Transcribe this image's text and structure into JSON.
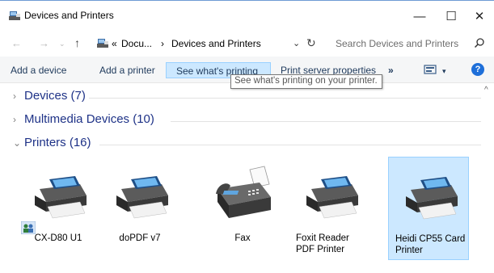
{
  "window": {
    "title": "Devices and Printers",
    "minimize_glyph": "—",
    "maximize_glyph": "☐",
    "close_glyph": "✕"
  },
  "address_bar": {
    "back_glyph": "←",
    "forward_glyph": "→",
    "recent_glyph": "⌄",
    "up_glyph": "↑",
    "overflow_chevron": "«",
    "crumbs": [
      "Docu...",
      "Devices and Printers"
    ],
    "crumb_separator": "›",
    "dropdown_glyph": "⌄",
    "refresh_glyph": "↻"
  },
  "search": {
    "placeholder": "Search Devices and Printers"
  },
  "toolbar": {
    "add_device": "Add a device",
    "add_printer": "Add a printer",
    "see_printing": "See what's printing",
    "print_server": "Print server properties",
    "more": "»",
    "view_dropdown": "▾",
    "help": "?"
  },
  "tooltip": {
    "text": "See what's printing on your printer."
  },
  "groups": [
    {
      "label": "Devices (7)",
      "chevron": "›"
    },
    {
      "label": "Multimedia Devices (10)",
      "chevron": "›"
    },
    {
      "label": "Printers (16)",
      "chevron": "⌄"
    }
  ],
  "devices": [
    {
      "label": "CX-D80 U1",
      "icon": "printer-icon"
    },
    {
      "label": "doPDF v7",
      "icon": "printer-icon"
    },
    {
      "label": "Fax",
      "icon": "fax-icon"
    },
    {
      "label": "Foxit Reader PDF Printer",
      "icon": "printer-icon"
    },
    {
      "label": "Heidi CP55 Card Printer",
      "icon": "printer-icon",
      "selected": true
    }
  ],
  "colors": {
    "accent": "#cce8ff",
    "accent_border": "#99d1ff",
    "group_text": "#1e3287",
    "help_blue": "#1e6fd9"
  },
  "scrollbar": {
    "up_glyph": "^"
  }
}
